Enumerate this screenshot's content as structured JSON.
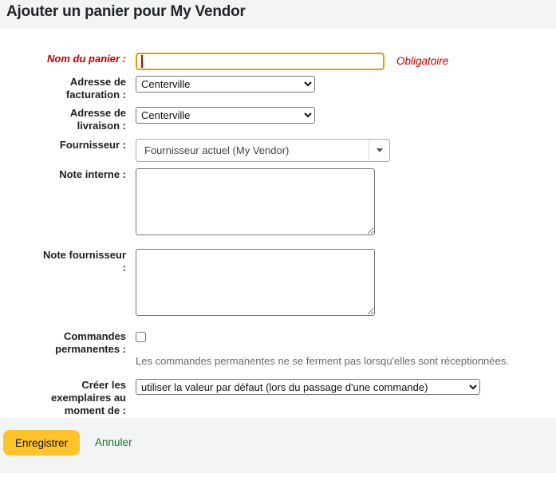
{
  "page_title": "Ajouter un panier pour My Vendor",
  "form": {
    "fields": {
      "basket_name": {
        "label": "Nom du panier :",
        "value": "",
        "required_note": "Obligatoire"
      },
      "billing_place": {
        "label": "Adresse de\nfacturation :",
        "value": "Centerville"
      },
      "delivery_place": {
        "label": "Adresse de\nlivraison :",
        "value": "Centerville"
      },
      "vendor": {
        "label": "Fournisseur :",
        "value": "Fournisseur actuel (My Vendor)"
      },
      "internal_note": {
        "label": "Note interne :",
        "value": ""
      },
      "vendor_note": {
        "label": "Note fournisseur\n:",
        "value": ""
      },
      "standing_orders": {
        "label": "Commandes\npermanentes :",
        "checked": false,
        "hint": "Les commandes permanentes ne se ferment pas lorsqu'elles sont réceptionnées."
      },
      "create_items": {
        "label": "Créer les\nexemplaires au\nmoment de :",
        "value": "utiliser la valeur par défaut (lors du passage d'une commande)"
      }
    },
    "actions": {
      "save_label": "Enregistrer",
      "cancel_label": "Annuler"
    }
  },
  "colors": {
    "band_gray": "#f3f4f4",
    "required_red": "#c00000",
    "focus_border_gold": "#e0a000",
    "save_button_yellow": "#ffc32e",
    "cancel_link_green": "#177323",
    "hint_gray": "#696969"
  }
}
